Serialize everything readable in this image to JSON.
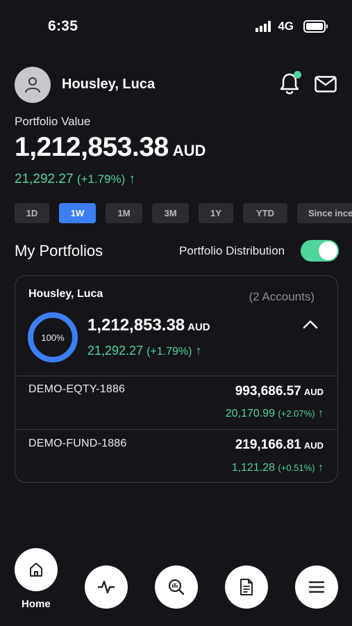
{
  "status_bar": {
    "time": "6:35",
    "network": "4G"
  },
  "header": {
    "user_name": "Housley, Luca"
  },
  "portfolio": {
    "label": "Portfolio Value",
    "value": "1,212,853.38",
    "currency": "AUD",
    "change": "21,292.27",
    "change_pct": "(+1.79%)",
    "arrow": "↑"
  },
  "periods": [
    "1D",
    "1W",
    "1M",
    "3M",
    "1Y",
    "YTD",
    "Since ince"
  ],
  "active_period": "1W",
  "section": {
    "title": "My Portfolios",
    "distribution_label": "Portfolio Distribution",
    "distribution_on": true
  },
  "card": {
    "name": "Housley, Luca",
    "accounts": "(2 Accounts)",
    "donut_label": "100%",
    "value": "1,212,853.38",
    "currency": "AUD",
    "change": "21,292.27",
    "change_pct": "(+1.79%)",
    "arrow": "↑",
    "items": [
      {
        "name": "DEMO-EQTY-1886",
        "value": "993,686.57",
        "currency": "AUD",
        "change": "20,170.99",
        "change_pct": "(+2.07%)",
        "arrow": "↑"
      },
      {
        "name": "DEMO-FUND-1886",
        "value": "219,166.81",
        "currency": "AUD",
        "change": "1,121.28",
        "change_pct": "(+0.51%)",
        "arrow": "↑"
      }
    ]
  },
  "bottom_nav": {
    "home_label": "Home"
  },
  "colors": {
    "background": "#141419",
    "accent": "#3d7ef5",
    "positive": "#4fd69c"
  },
  "icons": [
    "user-icon",
    "bell-icon",
    "mail-icon",
    "chevron-up-icon",
    "home-icon",
    "activity-icon",
    "search-chart-icon",
    "document-icon",
    "menu-icon"
  ]
}
